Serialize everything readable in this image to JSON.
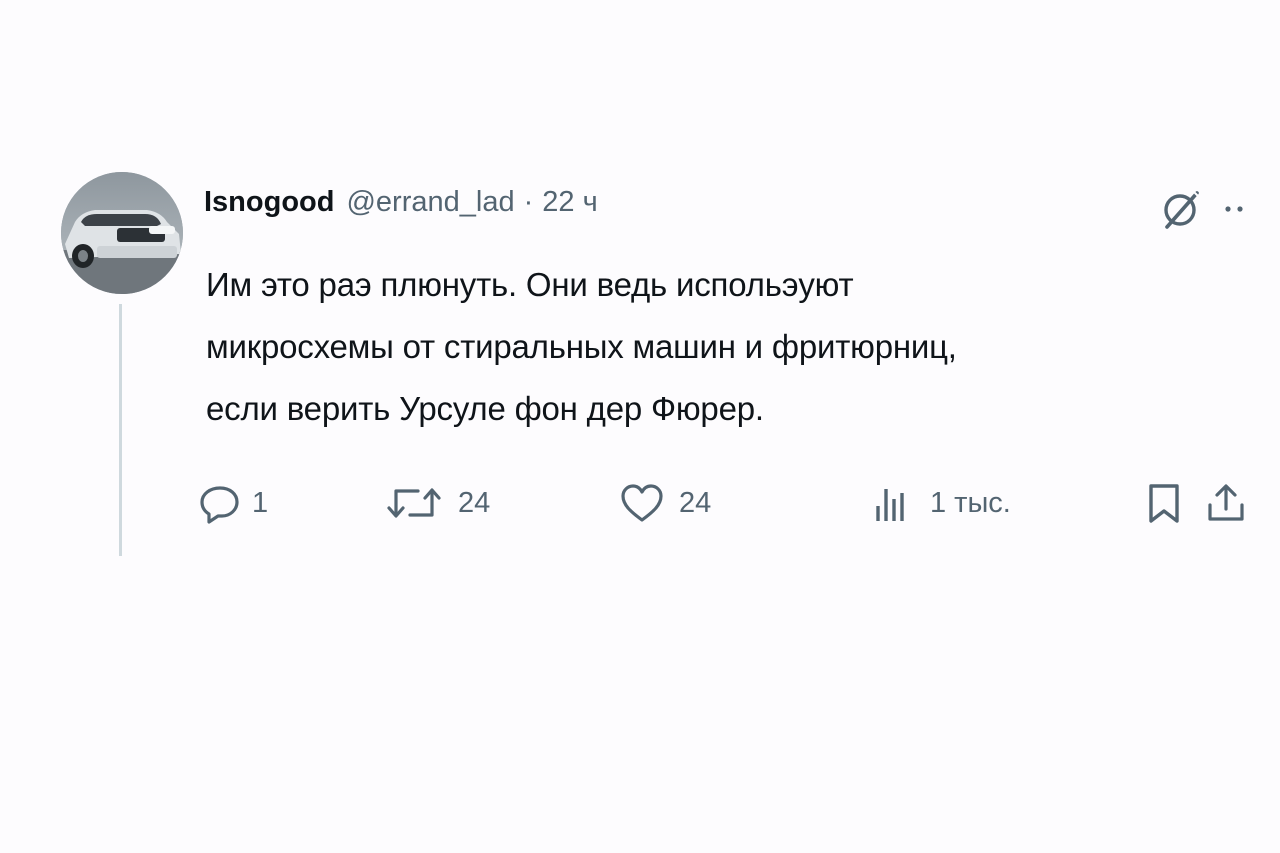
{
  "author": {
    "display_name": "Isnogood",
    "handle": "@errand_lad",
    "separator": "·",
    "time": "22 ч"
  },
  "post": {
    "lines": [
      "Им это раэ плюнуть. Они ведь испольэуют",
      "микросхемы от стиральных машин и фритюрниц,",
      "если верить Урсуле фон дер Фюрер."
    ]
  },
  "actions": {
    "reply_count": "1",
    "repost_count": "24",
    "like_count": "24",
    "views_count": "1 тыс."
  },
  "icons": [
    "avatar-car",
    "grok-icon",
    "more-icon",
    "reply-icon",
    "repost-icon",
    "like-icon",
    "views-icon",
    "bookmark-icon",
    "share-icon"
  ],
  "colors": {
    "text": "#0f1419",
    "secondary": "#536471",
    "thread_line": "#cfd9de",
    "background": "#fdfcfe"
  }
}
